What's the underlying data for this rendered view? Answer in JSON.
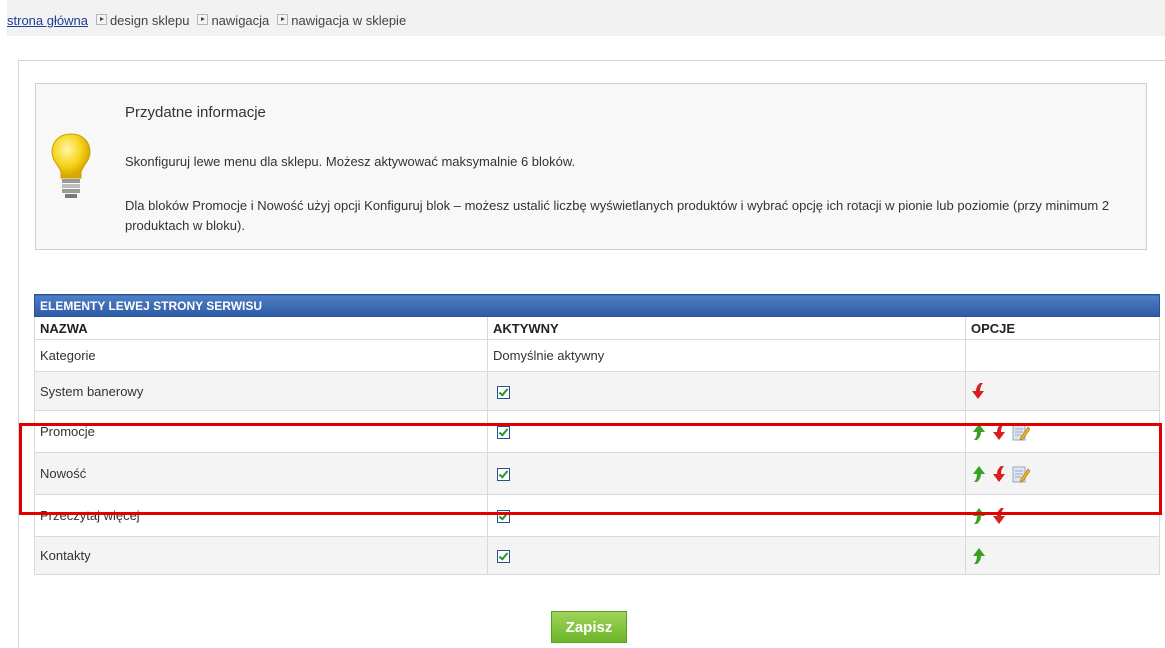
{
  "breadcrumb": {
    "home": "strona główna",
    "items": [
      "design sklepu",
      "nawigacja",
      "nawigacja w sklepie"
    ]
  },
  "info": {
    "title": "Przydatne informacje",
    "line1": "Skonfiguruj lewe menu dla sklepu. Możesz aktywować maksymalnie 6 bloków.",
    "line2": "Dla bloków Promocje i Nowość użyj opcji Konfiguruj blok – możesz ustalić liczbę wyświetlanych produktów i wybrać opcję ich rotacji w pionie lub poziomie (przy minimum 2 produktach w bloku)."
  },
  "table": {
    "title": "ELEMENTY LEWEJ STRONY SERWISU",
    "headers": [
      "NAZWA",
      "AKTYWNY",
      "OPCJE"
    ],
    "rows": [
      {
        "name": "Kategorie",
        "active": "Domyślnie aktywny",
        "options": []
      },
      {
        "name": "System banerowy",
        "active": "checked",
        "options": [
          "down"
        ]
      },
      {
        "name": "Promocje",
        "active": "checked",
        "options": [
          "up",
          "down",
          "edit"
        ]
      },
      {
        "name": "Nowość",
        "active": "checked",
        "options": [
          "up",
          "down",
          "edit"
        ]
      },
      {
        "name": "Przeczytaj więcej",
        "active": "checked",
        "options": [
          "up",
          "down"
        ]
      },
      {
        "name": "Kontakty",
        "active": "checked",
        "options": [
          "up"
        ]
      }
    ]
  },
  "save_label": "Zapisz",
  "colors": {
    "header_blue": "#2d5aa6",
    "highlight_red": "#e00000",
    "save_green": "#6cb528",
    "arrow_up": "#3aa021",
    "arrow_down": "#d42020"
  }
}
